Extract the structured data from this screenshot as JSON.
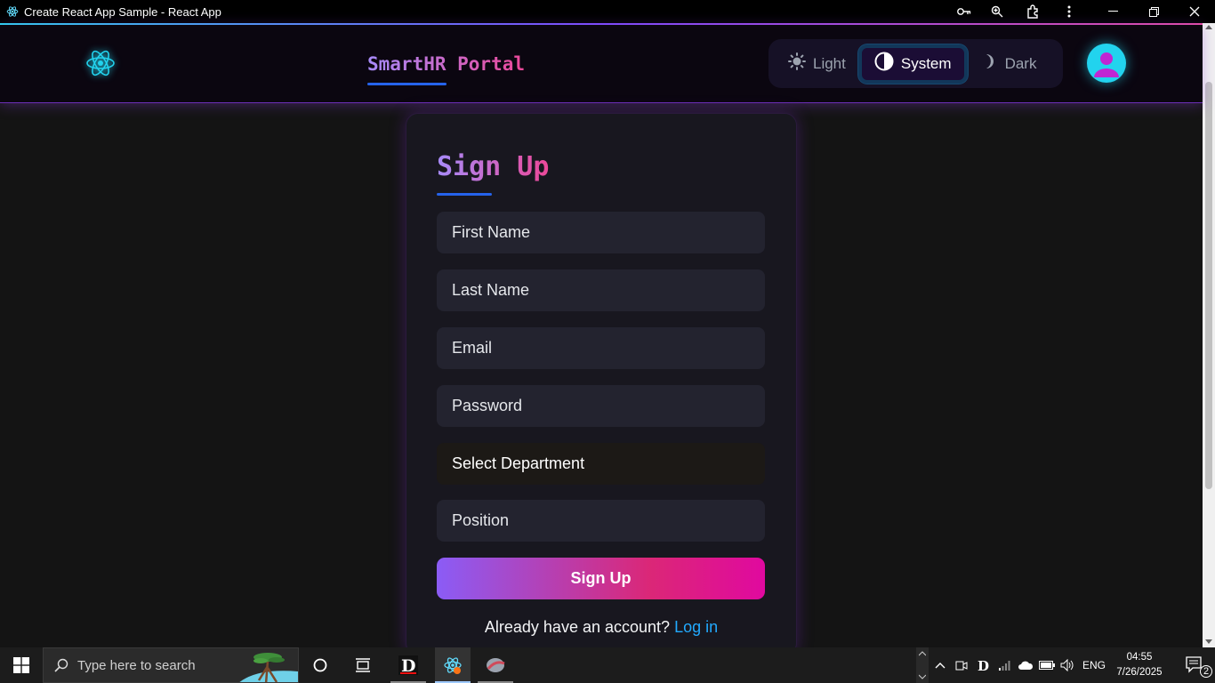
{
  "window": {
    "title": "Create React App Sample - React App",
    "controls": [
      "key-icon",
      "zoom-icon",
      "extensions-icon",
      "more-icon",
      "minimize-icon",
      "restore-icon",
      "close-icon"
    ]
  },
  "header": {
    "brand": "SmartHR Portal",
    "theme_options": [
      {
        "label": "Light",
        "icon": "sun-icon",
        "active": false
      },
      {
        "label": "System",
        "icon": "contrast-icon",
        "active": true
      },
      {
        "label": "Dark",
        "icon": "moon-icon",
        "active": false
      }
    ]
  },
  "form": {
    "title": "Sign Up",
    "fields": {
      "first_name": "First Name",
      "last_name": "Last Name",
      "email": "Email",
      "password": "Password",
      "department": "Select Department",
      "position": "Position"
    },
    "submit_label": "Sign Up",
    "login_prompt": "Already have an account?",
    "login_link": "Log in"
  },
  "taskbar": {
    "search_placeholder": "Type here to search",
    "language": "ENG",
    "time": "04:55",
    "date": "7/26/2025",
    "notification_count": "2"
  },
  "colors": {
    "accent": "#2563eb",
    "gradient_start": "#8b5cf6",
    "gradient_end": "#db2777",
    "link": "#22aaff",
    "avatar": "#22d3ee"
  }
}
